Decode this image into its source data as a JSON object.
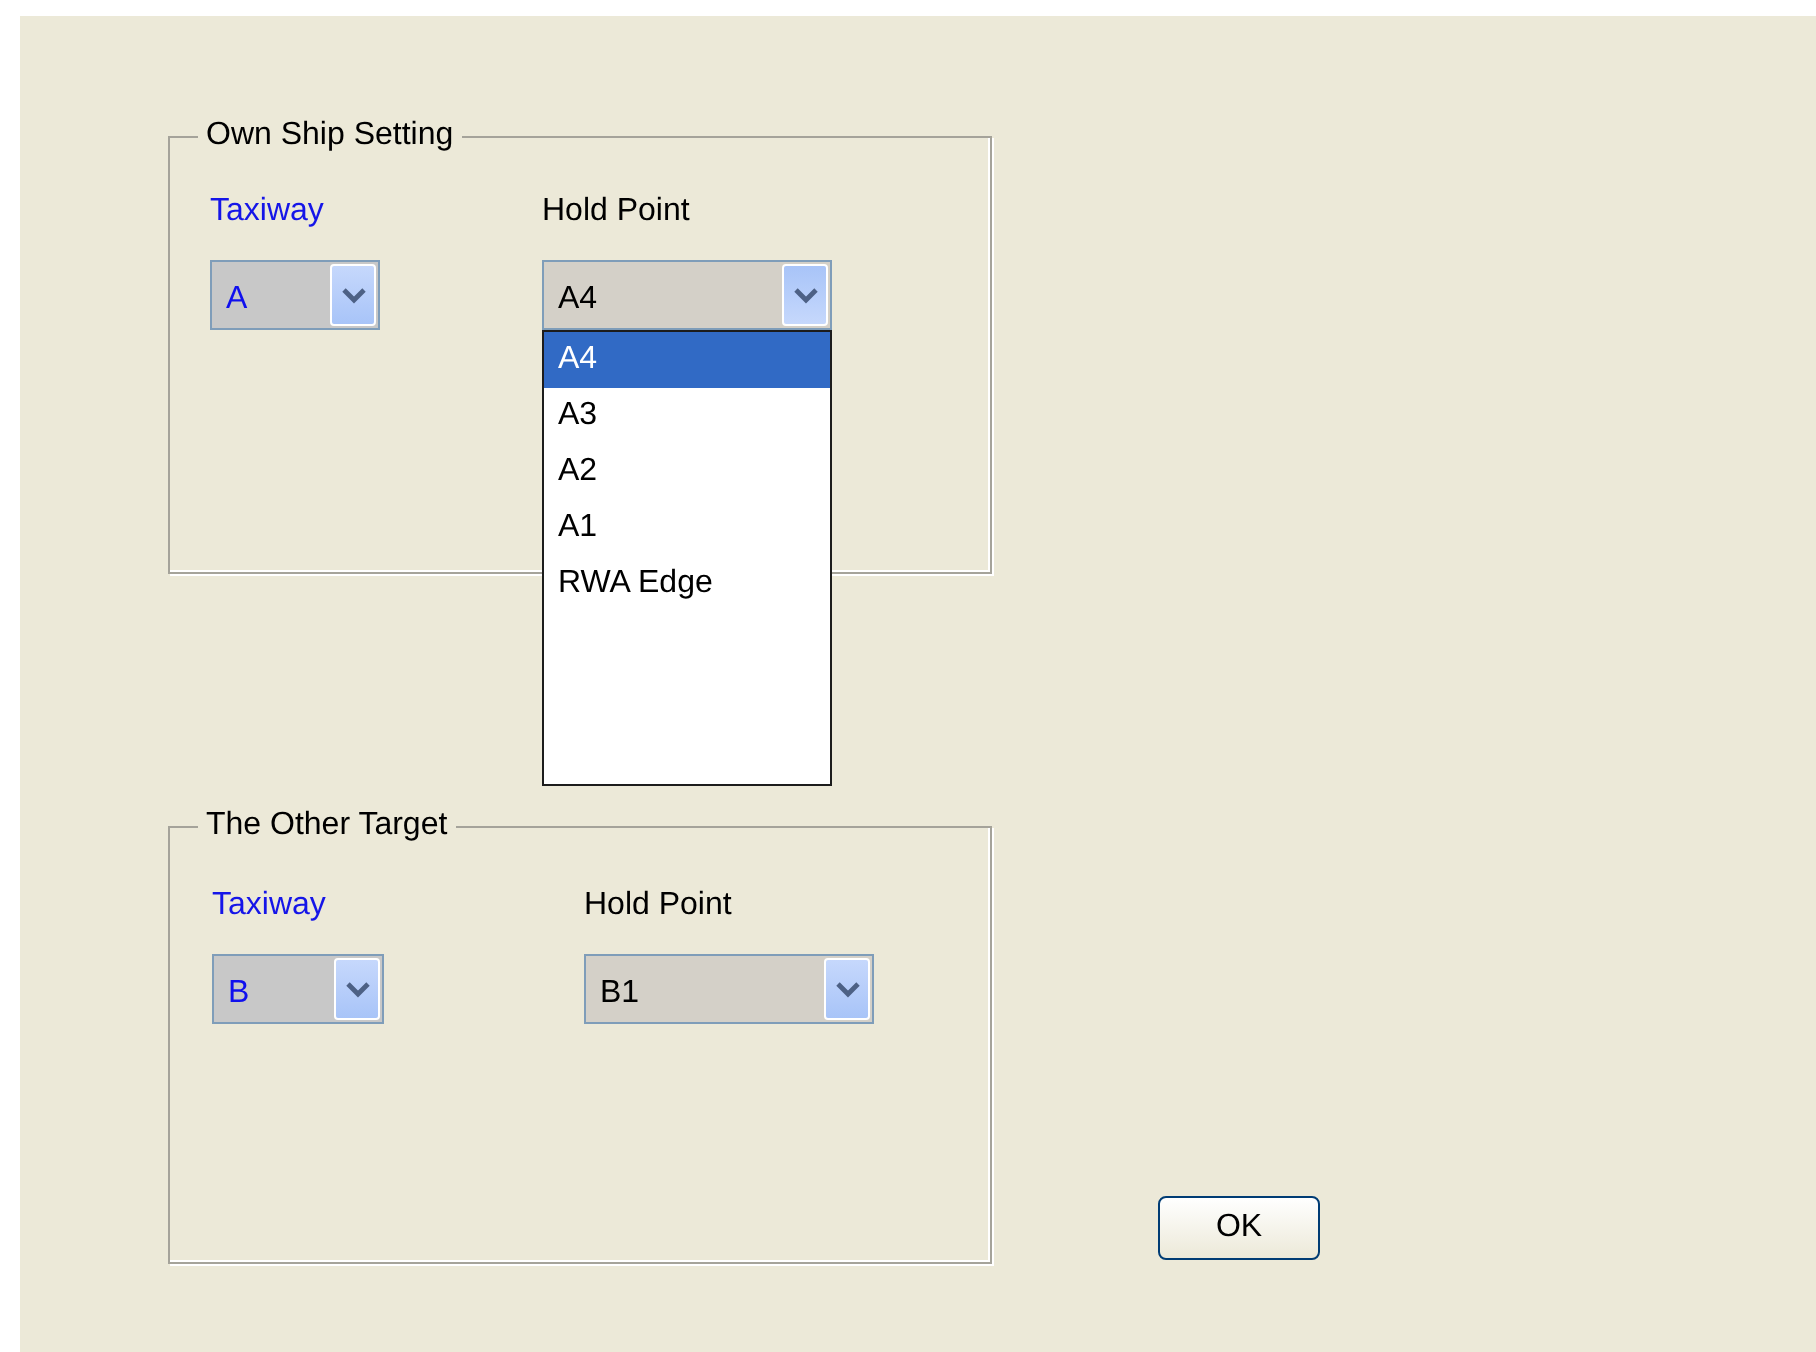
{
  "groups": [
    {
      "title": "Own Ship Setting",
      "taxiway": {
        "label": "Taxiway",
        "value": "A"
      },
      "hold_point": {
        "label": "Hold Point",
        "value": "A4",
        "expanded": true,
        "options": [
          {
            "label": "A4",
            "selected": true
          },
          {
            "label": "A3",
            "selected": false
          },
          {
            "label": "A2",
            "selected": false
          },
          {
            "label": "A1",
            "selected": false
          },
          {
            "label": "RWA Edge",
            "selected": false
          }
        ]
      }
    },
    {
      "title": "The Other Target",
      "taxiway": {
        "label": "Taxiway",
        "value": "B"
      },
      "hold_point": {
        "label": "Hold Point",
        "value": "B1",
        "expanded": false
      }
    }
  ],
  "ok_button": "OK"
}
